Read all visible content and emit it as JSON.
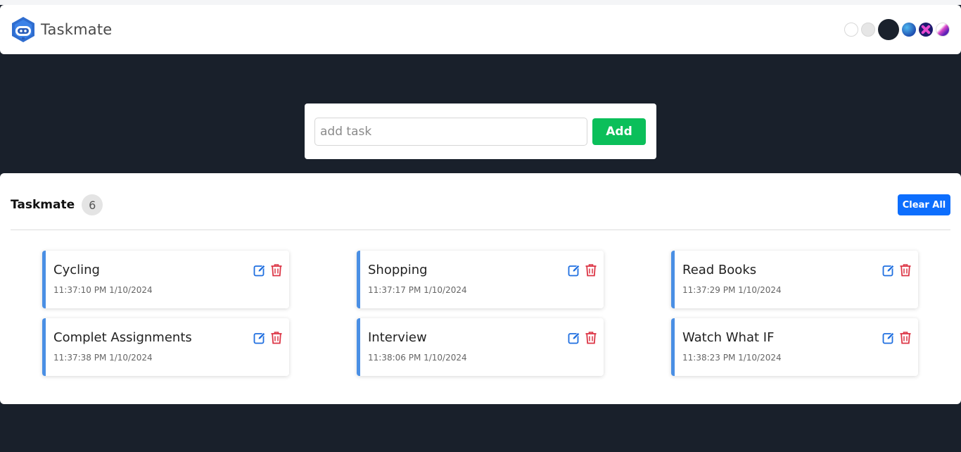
{
  "header": {
    "brand_name": "Taskmate",
    "logo_icon": "robot-logo-icon",
    "themes": [
      "light",
      "grey",
      "dark",
      "blue",
      "cross",
      "pink"
    ]
  },
  "add_form": {
    "placeholder": "add task",
    "value": "",
    "add_label": "Add"
  },
  "list": {
    "title": "Taskmate",
    "count": "6",
    "clear_label": "Clear All",
    "tasks": [
      {
        "name": "Cycling",
        "time": "11:37:10 PM 1/10/2024"
      },
      {
        "name": "Shopping",
        "time": "11:37:17 PM 1/10/2024"
      },
      {
        "name": "Read Books",
        "time": "11:37:29 PM 1/10/2024"
      },
      {
        "name": "Complet Assignments",
        "time": "11:37:38 PM 1/10/2024"
      },
      {
        "name": "Interview",
        "time": "11:38:06 PM 1/10/2024"
      },
      {
        "name": "Watch What IF",
        "time": "11:38:23 PM 1/10/2024"
      }
    ]
  },
  "colors": {
    "background": "#19202b",
    "add_button": "#0bbf5a",
    "clear_button": "#0d6efd",
    "card_accent": "#4a8fe4",
    "edit_icon": "#1f6fe0",
    "delete_icon": "#dc3545"
  }
}
